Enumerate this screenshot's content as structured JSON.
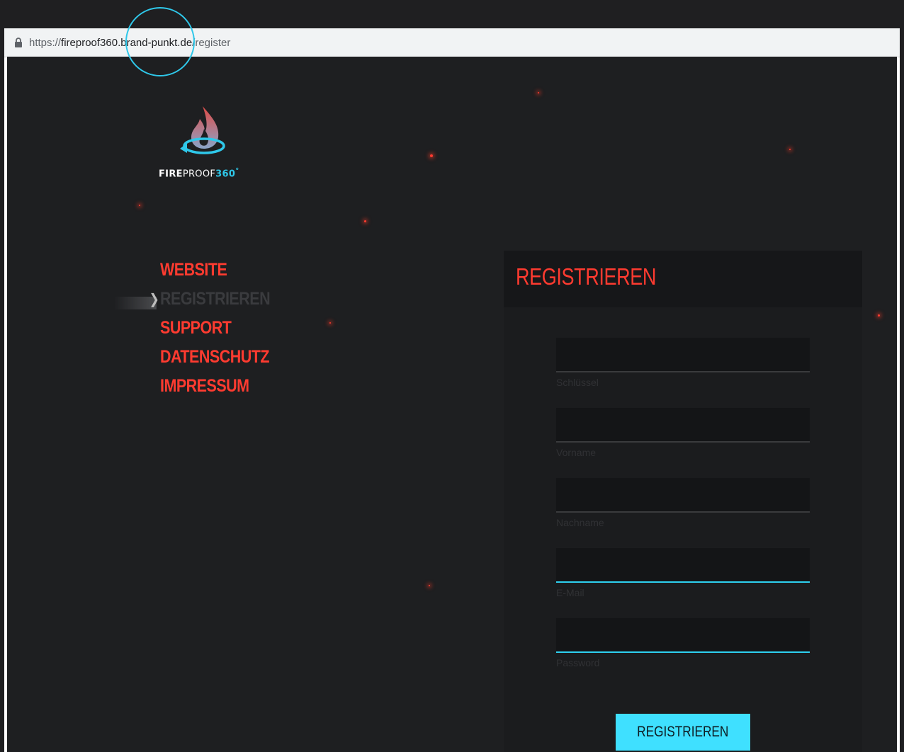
{
  "browser": {
    "url_scheme": "https://",
    "url_host": "fireproof360.brand-punkt.de",
    "url_path": "/register"
  },
  "logo": {
    "text_part1": "FIRE",
    "text_part2": "PROOF",
    "text_part3": "360",
    "text_mark": "°"
  },
  "nav": {
    "items": [
      {
        "label": "WEBSITE",
        "active": false
      },
      {
        "label": "REGISTRIEREN",
        "active": true
      },
      {
        "label": "SUPPORT",
        "active": false
      },
      {
        "label": "DATENSCHUTZ",
        "active": false
      },
      {
        "label": "IMPRESSUM",
        "active": false
      }
    ],
    "chevron": "❯"
  },
  "form": {
    "title": "REGISTRIEREN",
    "fields": [
      {
        "label": "Schlüssel",
        "value": ""
      },
      {
        "label": "Vorname",
        "value": ""
      },
      {
        "label": "Nachname",
        "value": ""
      },
      {
        "label": "E-Mail",
        "value": ""
      },
      {
        "label": "Password",
        "value": ""
      }
    ],
    "submit_label": "REGISTRIEREN"
  },
  "colors": {
    "accent_red": "#ff3b30",
    "accent_cyan": "#3fe0ff",
    "background": "#1e1f21"
  },
  "icons": {
    "lock": "lock-icon",
    "logo": "flame-logo-icon"
  }
}
